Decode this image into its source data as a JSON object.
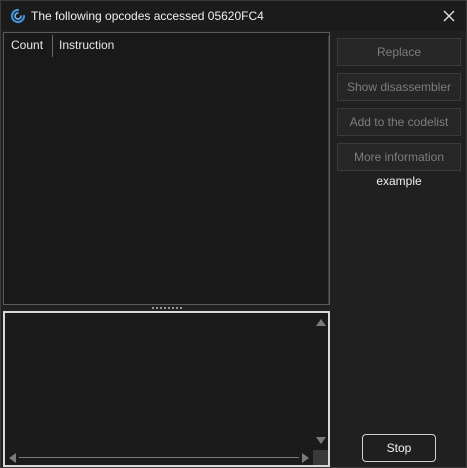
{
  "window": {
    "title": "The following opcodes accessed 05620FC4",
    "app_icon": "cheat-engine-icon",
    "close_icon": "close-icon"
  },
  "opcode_list": {
    "columns": [
      "Count",
      "Instruction"
    ],
    "rows": []
  },
  "info_box": {
    "text": ""
  },
  "buttons": {
    "replace": "Replace",
    "show_disassembler": "Show disassembler",
    "add_to_codelist": "Add to the codelist",
    "more_information": "More information",
    "stop": "Stop"
  },
  "example_label": "example",
  "colors": {
    "background": "#202020",
    "titlebar": "#1b1b1b",
    "disabled_text": "#7d7d7d",
    "text": "#e6e6e6"
  }
}
